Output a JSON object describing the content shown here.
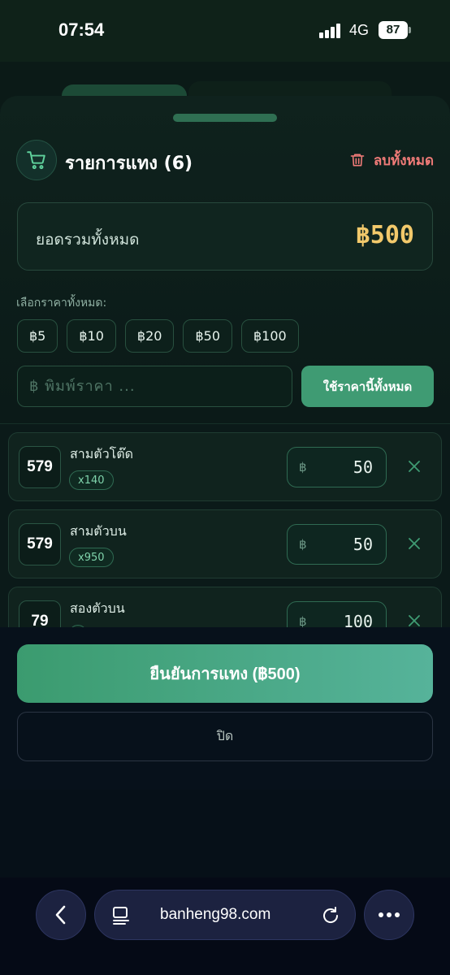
{
  "status_bar": {
    "time": "07:54",
    "network": "4G",
    "battery": "87"
  },
  "sheet": {
    "title": "รายการแทง (6)",
    "clear_all_label": "ลบทั้งหมด",
    "total_label": "ยอดรวมทั้งหมด",
    "total_value": "฿500",
    "pick_price_label": "เลือกราคาทั้งหมด:",
    "price_chips": [
      "฿5",
      "฿10",
      "฿20",
      "฿50",
      "฿100"
    ],
    "price_input_placeholder": "฿ พิมพ์ราคา ...",
    "apply_all_label": "ใช้ราคานี้ทั้งหมด"
  },
  "bets": [
    {
      "number": "579",
      "type": "สามตัวโต๊ด",
      "odds": "x140",
      "amount": "50"
    },
    {
      "number": "579",
      "type": "สามตัวบน",
      "odds": "x950",
      "amount": "50"
    },
    {
      "number": "79",
      "type": "สองตัวบน",
      "odds": "",
      "amount": "100"
    }
  ],
  "currency_symbol": "฿",
  "actions": {
    "confirm_label": "ยืนยันการแทง (฿500)",
    "close_label": "ปิด"
  },
  "browser": {
    "url": "banheng98.com"
  },
  "colors": {
    "accent_green": "#3f9b73",
    "gold_total": "#f2c96b",
    "danger_red": "#f07b78",
    "background": "#061018"
  },
  "icons": {
    "cart": "shopping-cart-icon",
    "clear": "trash-icon",
    "remove": "close-icon",
    "back": "chevron-left-icon",
    "tabs": "tabs-icon",
    "reload": "reload-icon",
    "more": "more-icon"
  }
}
